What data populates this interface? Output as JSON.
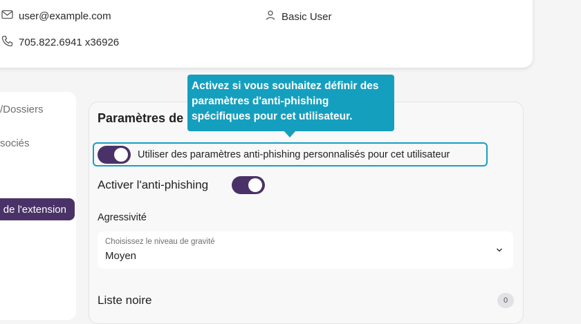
{
  "user": {
    "email": "user@example.com",
    "role": "Basic User",
    "phone": "705.822.6941 x36926",
    "icons": {
      "email": "envelope-icon",
      "role": "user-icon",
      "phone": "phone-icon"
    }
  },
  "nav": {
    "items": [
      "/Dossiers",
      "sociés"
    ],
    "extension_button": "de l'extension"
  },
  "settings": {
    "section_title": "Paramètres de",
    "tooltip": "Activez si vous souhaitez définir des paramètres d'anti-phishing spécifiques pour cet utilisateur.",
    "custom_toggle": {
      "label": "Utiliser des paramètres anti-phishing personnalisés pour cet utilisateur",
      "on": true
    },
    "anti_phishing": {
      "label": "Activer l'anti-phishing",
      "on": true
    },
    "aggressiveness": {
      "label": "Agressivité",
      "placeholder": "Choisissez le niveau de gravité",
      "value": "Moyen"
    },
    "blacklist": {
      "label": "Liste noire",
      "count": "0"
    }
  },
  "colors": {
    "accent": "#4a3268",
    "tooltip": "#159fbf"
  }
}
